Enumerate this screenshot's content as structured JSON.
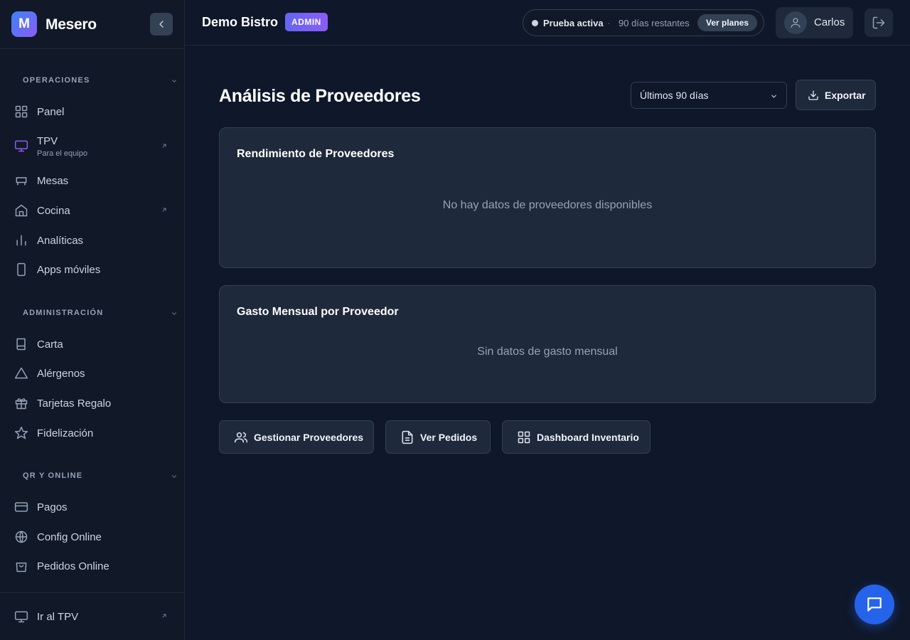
{
  "app": {
    "logo_letter": "M",
    "name": "Mesero"
  },
  "sidebar": {
    "sections": [
      {
        "title": "OPERACIONES",
        "items": [
          {
            "label": "Panel",
            "icon": "grid-icon"
          },
          {
            "label": "TPV",
            "sub": "Para el equipo",
            "icon": "monitor-icon",
            "external": true
          },
          {
            "label": "Mesas",
            "icon": "table-icon"
          },
          {
            "label": "Cocina",
            "icon": "home-icon",
            "external": true
          },
          {
            "label": "Analíticas",
            "icon": "bar-chart-icon"
          },
          {
            "label": "Apps móviles",
            "icon": "smartphone-icon"
          }
        ]
      },
      {
        "title": "ADMINISTRACIÓN",
        "items": [
          {
            "label": "Carta",
            "icon": "book-icon"
          },
          {
            "label": "Alérgenos",
            "icon": "warning-triangle-icon"
          },
          {
            "label": "Tarjetas Regalo",
            "icon": "gift-icon"
          },
          {
            "label": "Fidelización",
            "icon": "star-icon"
          }
        ]
      },
      {
        "title": "QR Y ONLINE",
        "items": [
          {
            "label": "Pagos",
            "icon": "credit-card-icon"
          },
          {
            "label": "Config Online",
            "icon": "globe-icon"
          },
          {
            "label": "Pedidos Online",
            "icon": "shopping-bag-icon"
          }
        ]
      }
    ],
    "footer": {
      "label": "Ir al TPV",
      "icon": "monitor-icon"
    }
  },
  "header": {
    "venue": "Demo Bistro",
    "role_badge": "ADMIN",
    "trial": {
      "status": "Prueba activa",
      "separator": "·",
      "remaining": "90 días restantes",
      "plans_button": "Ver planes"
    },
    "user": {
      "name": "Carlos"
    }
  },
  "main": {
    "title": "Análisis de Proveedores",
    "period": {
      "selected": "Últimos 90 días"
    },
    "export_label": "Exportar",
    "cards": [
      {
        "title": "Rendimiento de Proveedores",
        "empty": "No hay datos de proveedores disponibles"
      },
      {
        "title": "Gasto Mensual por Proveedor",
        "empty": "Sin datos de gasto mensual"
      }
    ],
    "actions": [
      {
        "label": "Gestionar Proveedores",
        "icon": "users-icon"
      },
      {
        "label": "Ver Pedidos",
        "icon": "file-text-icon"
      },
      {
        "label": "Dashboard Inventario",
        "icon": "grid-icon"
      }
    ]
  },
  "colors": {
    "background": "#0f172a",
    "sidebar": "#111827",
    "card": "#1e293b",
    "border": "#334155",
    "accent": "#2563eb",
    "brand_gradient_start": "#3b82f6",
    "brand_gradient_end": "#8b5cf6"
  }
}
